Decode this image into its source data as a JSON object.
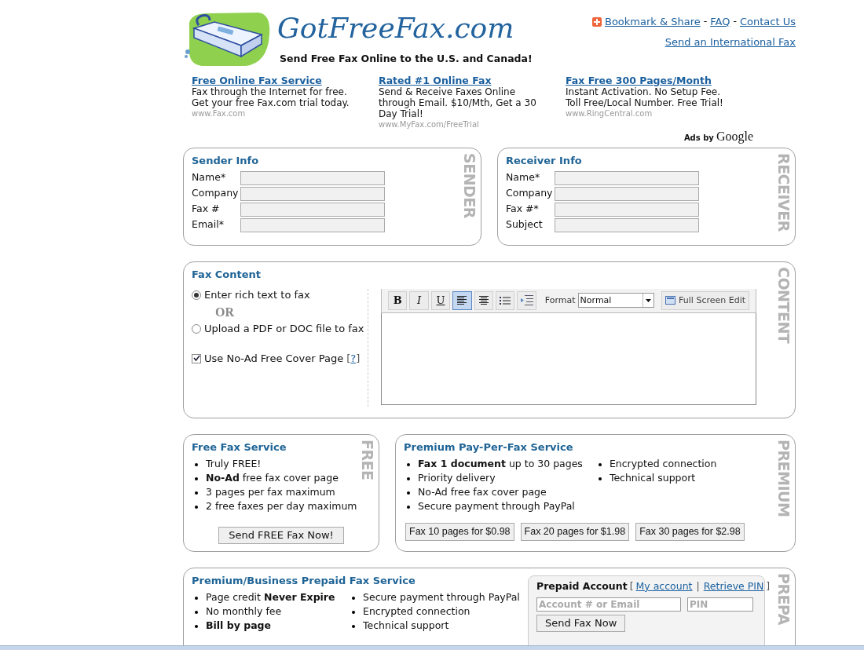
{
  "header": {
    "logo_text": "GotFreeFax.com",
    "tagline": "Send Free Fax Online to the U.S. and Canada!",
    "separator": "-",
    "links": [
      {
        "label": "Bookmark & Share",
        "kind": "share"
      },
      {
        "label": "FAQ",
        "kind": "link"
      },
      {
        "label": "Contact Us",
        "kind": "link"
      }
    ],
    "international_link": "Send an International Fax"
  },
  "ads": [
    {
      "title": "Free Online Fax Service",
      "lines": [
        "Fax through the Internet for free.",
        "Get your free Fax.com trial today."
      ],
      "url": "www.Fax.com"
    },
    {
      "title": "Rated #1 Online Fax",
      "lines": [
        "Send & Receive Faxes Online",
        "through Email. $10/Mth, Get a 30",
        "Day Trial!"
      ],
      "url": "www.MyFax.com/FreeTrial"
    },
    {
      "title": "Fax Free 300 Pages/Month",
      "lines": [
        "Instant Activation. No Setup Fee.",
        "Toll Free/Local Number. Free Trial!"
      ],
      "url": "www.RingCentral.com"
    }
  ],
  "ads_label": {
    "prefix": "Ads by",
    "brand": "Google"
  },
  "sender": {
    "title": "Sender Info",
    "watermark": "SENDER",
    "fields": [
      {
        "label": "Name*"
      },
      {
        "label": "Company"
      },
      {
        "label": "Fax #"
      },
      {
        "label": "Email*"
      }
    ]
  },
  "receiver": {
    "title": "Receiver Info",
    "watermark": "RECEIVER",
    "fields": [
      {
        "label": "Name*"
      },
      {
        "label": "Company"
      },
      {
        "label": "Fax #*"
      },
      {
        "label": "Subject"
      }
    ]
  },
  "content": {
    "title": "Fax Content",
    "watermark": "CONTENT",
    "or_text": "OR",
    "options": [
      {
        "label": "Enter rich text to fax",
        "selected": true
      },
      {
        "label": "Upload a PDF or DOC file to fax",
        "selected": false
      }
    ],
    "cover_page": {
      "label": "Use No-Ad Free Cover Page",
      "checked": true,
      "open": "[",
      "help": "?",
      "close": "]"
    },
    "editor": {
      "toolbar": [
        {
          "kind": "bold",
          "label": "B",
          "selected": false
        },
        {
          "kind": "italic",
          "label": "I",
          "selected": false
        },
        {
          "kind": "underline",
          "label": "U",
          "selected": false
        },
        {
          "kind": "align-left",
          "selected": true
        },
        {
          "kind": "align-center",
          "selected": false
        },
        {
          "kind": "list",
          "selected": false
        },
        {
          "kind": "indent",
          "selected": false
        }
      ],
      "format_label": "Format",
      "format_value": "Normal",
      "fullscreen": "Full Screen Edit"
    }
  },
  "free": {
    "title": "Free Fax Service",
    "watermark": "FREE",
    "items": [
      {
        "text": "Truly FREE!",
        "bold": false
      },
      {
        "text": "**No-Ad** free fax cover page",
        "bold": false
      },
      {
        "text": "3 pages per fax maximum",
        "bold": false
      },
      {
        "text": "2 free faxes per day maximum",
        "bold": false
      }
    ],
    "button": "Send FREE Fax Now!"
  },
  "premium": {
    "title": "Premium Pay-Per-Fax Service",
    "watermark": "PREMIUM",
    "items_left": [
      {
        "text": "**Fax 1 document** up to 30 pages",
        "bold": false
      },
      {
        "text": "Priority delivery",
        "bold": false
      },
      {
        "text": "No-Ad free fax cover page",
        "bold": false
      },
      {
        "text": "Secure payment through PayPal",
        "bold": false
      }
    ],
    "items_right": [
      {
        "text": "Encrypted connection",
        "bold": false
      },
      {
        "text": "Technical support",
        "bold": false
      }
    ],
    "buttons": [
      "Fax 10 pages for $0.98",
      "Fax 20 pages for $1.98",
      "Fax 30 pages for $2.98"
    ]
  },
  "prepaid": {
    "title": "Premium/Business Prepaid Fax Service",
    "watermark": "PREPA",
    "items_left": [
      {
        "text": "Page credit **Never Expire**",
        "bold": false
      },
      {
        "text": "No monthly fee",
        "bold": false
      },
      {
        "text": "Bill by page",
        "bold": true
      }
    ],
    "items_right": [
      {
        "text": "Secure payment through PayPal",
        "bold": false
      },
      {
        "text": "Encrypted connection",
        "bold": false
      },
      {
        "text": "Technical support",
        "bold": false
      }
    ],
    "account": {
      "title": "Prepaid Account",
      "open": "[",
      "links": [
        "My account",
        "Retrieve PIN"
      ],
      "separator": "|",
      "close": "]",
      "account_placeholder": "Account # or Email",
      "pin_placeholder": "PIN",
      "button": "Send Fax Now"
    }
  }
}
